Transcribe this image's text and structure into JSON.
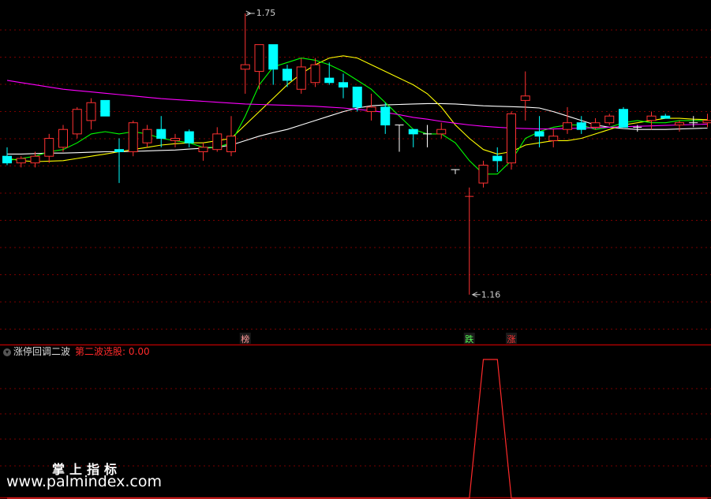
{
  "chart_data": [
    {
      "type": "candlestick",
      "ylim": [
        1.05,
        1.82
      ],
      "grid": true,
      "candles": [
        {
          "o": 1.47,
          "h": 1.49,
          "l": 1.45,
          "c": 1.455,
          "up": false
        },
        {
          "o": 1.455,
          "h": 1.47,
          "l": 1.445,
          "c": 1.465,
          "up": true
        },
        {
          "o": 1.455,
          "h": 1.48,
          "l": 1.445,
          "c": 1.47,
          "up": true
        },
        {
          "o": 1.47,
          "h": 1.52,
          "l": 1.455,
          "c": 1.51,
          "up": true
        },
        {
          "o": 1.49,
          "h": 1.54,
          "l": 1.48,
          "c": 1.53,
          "up": true
        },
        {
          "o": 1.52,
          "h": 1.58,
          "l": 1.51,
          "c": 1.575,
          "up": true
        },
        {
          "o": 1.55,
          "h": 1.6,
          "l": 1.53,
          "c": 1.59,
          "up": true
        },
        {
          "o": 1.595,
          "h": 1.595,
          "l": 1.56,
          "c": 1.56,
          "up": false
        },
        {
          "o": 1.485,
          "h": 1.51,
          "l": 1.41,
          "c": 1.48,
          "up": false
        },
        {
          "o": 1.48,
          "h": 1.55,
          "l": 1.47,
          "c": 1.545,
          "up": true
        },
        {
          "o": 1.5,
          "h": 1.54,
          "l": 1.49,
          "c": 1.53,
          "up": true
        },
        {
          "o": 1.53,
          "h": 1.56,
          "l": 1.49,
          "c": 1.51,
          "up": false
        },
        {
          "o": 1.51,
          "h": 1.52,
          "l": 1.49,
          "c": 1.505,
          "up": true
        },
        {
          "o": 1.525,
          "h": 1.53,
          "l": 1.49,
          "c": 1.5,
          "up": false
        },
        {
          "o": 1.48,
          "h": 1.5,
          "l": 1.46,
          "c": 1.49,
          "up": true
        },
        {
          "o": 1.485,
          "h": 1.535,
          "l": 1.48,
          "c": 1.52,
          "up": true
        },
        {
          "o": 1.48,
          "h": 1.56,
          "l": 1.47,
          "c": 1.515,
          "up": true
        },
        {
          "o": 1.665,
          "h": 1.79,
          "l": 1.61,
          "c": 1.675,
          "up": true
        },
        {
          "o": 1.72,
          "h": 1.72,
          "l": 1.62,
          "c": 1.66,
          "up": true
        },
        {
          "o": 1.72,
          "h": 1.72,
          "l": 1.63,
          "c": 1.665,
          "up": false
        },
        {
          "o": 1.665,
          "h": 1.675,
          "l": 1.625,
          "c": 1.64,
          "up": false
        },
        {
          "o": 1.62,
          "h": 1.69,
          "l": 1.61,
          "c": 1.67,
          "up": true
        },
        {
          "o": 1.635,
          "h": 1.69,
          "l": 1.625,
          "c": 1.675,
          "up": true
        },
        {
          "o": 1.645,
          "h": 1.68,
          "l": 1.63,
          "c": 1.635,
          "up": false
        },
        {
          "o": 1.635,
          "h": 1.655,
          "l": 1.6,
          "c": 1.625,
          "up": false
        },
        {
          "o": 1.625,
          "h": 1.625,
          "l": 1.57,
          "c": 1.58,
          "up": false
        },
        {
          "o": 1.58,
          "h": 1.61,
          "l": 1.55,
          "c": 1.57,
          "up": true
        },
        {
          "o": 1.58,
          "h": 1.59,
          "l": 1.52,
          "c": 1.54,
          "up": false
        },
        {
          "o": 1.54,
          "h": 1.54,
          "l": 1.48,
          "c": 1.54,
          "up": false
        },
        {
          "o": 1.53,
          "h": 1.53,
          "l": 1.49,
          "c": 1.52,
          "up": false
        },
        {
          "o": 1.52,
          "h": 1.54,
          "l": 1.49,
          "c": 1.52,
          "up": false
        },
        {
          "o": 1.52,
          "h": 1.545,
          "l": 1.51,
          "c": 1.53,
          "up": true
        },
        {
          "o": 1.44,
          "h": 1.44,
          "l": 1.43,
          "c": 1.44,
          "up": false
        },
        {
          "o": 1.38,
          "h": 1.4,
          "l": 1.16,
          "c": 1.38,
          "up": true
        },
        {
          "o": 1.41,
          "h": 1.46,
          "l": 1.4,
          "c": 1.45,
          "up": true
        },
        {
          "o": 1.46,
          "h": 1.49,
          "l": 1.435,
          "c": 1.47,
          "up": false
        },
        {
          "o": 1.455,
          "h": 1.57,
          "l": 1.44,
          "c": 1.565,
          "up": true
        },
        {
          "o": 1.595,
          "h": 1.66,
          "l": 1.55,
          "c": 1.605,
          "up": true
        },
        {
          "o": 1.525,
          "h": 1.56,
          "l": 1.49,
          "c": 1.515,
          "up": false
        },
        {
          "o": 1.505,
          "h": 1.53,
          "l": 1.49,
          "c": 1.515,
          "up": true
        },
        {
          "o": 1.53,
          "h": 1.58,
          "l": 1.52,
          "c": 1.545,
          "up": true
        },
        {
          "o": 1.545,
          "h": 1.56,
          "l": 1.52,
          "c": 1.53,
          "up": false
        },
        {
          "o": 1.535,
          "h": 1.555,
          "l": 1.53,
          "c": 1.545,
          "up": true
        },
        {
          "o": 1.545,
          "h": 1.565,
          "l": 1.54,
          "c": 1.56,
          "up": true
        },
        {
          "o": 1.575,
          "h": 1.58,
          "l": 1.535,
          "c": 1.535,
          "up": false
        },
        {
          "o": 1.535,
          "h": 1.54,
          "l": 1.525,
          "c": 1.535,
          "up": false
        },
        {
          "o": 1.55,
          "h": 1.57,
          "l": 1.53,
          "c": 1.56,
          "up": true
        },
        {
          "o": 1.56,
          "h": 1.565,
          "l": 1.555,
          "c": 1.555,
          "up": false
        },
        {
          "o": 1.54,
          "h": 1.55,
          "l": 1.525,
          "c": 1.545,
          "up": true
        },
        {
          "o": 1.545,
          "h": 1.56,
          "l": 1.535,
          "c": 1.545,
          "up": false
        },
        {
          "o": 1.545,
          "h": 1.565,
          "l": 1.535,
          "c": 1.55,
          "up": true
        }
      ],
      "series": [
        {
          "color": "#ffffff",
          "values": [
            1.475,
            1.475,
            1.476,
            1.477,
            1.477,
            1.478,
            1.479,
            1.48,
            1.48,
            1.481,
            1.482,
            1.483,
            1.484,
            1.486,
            1.488,
            1.49,
            1.495,
            1.505,
            1.515,
            1.523,
            1.53,
            1.54,
            1.55,
            1.56,
            1.57,
            1.578,
            1.583,
            1.585,
            1.586,
            1.587,
            1.588,
            1.588,
            1.587,
            1.585,
            1.583,
            1.582,
            1.581,
            1.58,
            1.578,
            1.57,
            1.56,
            1.55,
            1.54,
            1.535,
            1.532,
            1.53,
            1.53,
            1.53,
            1.531,
            1.532,
            1.533
          ]
        },
        {
          "color": "#ffff00",
          "values": [
            1.465,
            1.46,
            1.458,
            1.459,
            1.46,
            1.465,
            1.47,
            1.475,
            1.48,
            1.485,
            1.49,
            1.495,
            1.498,
            1.5,
            1.5,
            1.505,
            1.51,
            1.54,
            1.57,
            1.6,
            1.63,
            1.655,
            1.675,
            1.69,
            1.695,
            1.69,
            1.675,
            1.66,
            1.645,
            1.63,
            1.61,
            1.58,
            1.54,
            1.51,
            1.485,
            1.475,
            1.48,
            1.495,
            1.5,
            1.505,
            1.505,
            1.51,
            1.52,
            1.53,
            1.54,
            1.545,
            1.55,
            1.555,
            1.555,
            1.553,
            1.552
          ]
        },
        {
          "color": "#00ff00",
          "values": [
            1.46,
            1.465,
            1.47,
            1.48,
            1.485,
            1.5,
            1.52,
            1.525,
            1.52,
            1.525,
            1.52,
            1.51,
            1.505,
            1.5,
            1.49,
            1.49,
            1.5,
            1.56,
            1.63,
            1.67,
            1.68,
            1.69,
            1.685,
            1.675,
            1.66,
            1.64,
            1.62,
            1.59,
            1.56,
            1.53,
            1.52,
            1.52,
            1.5,
            1.46,
            1.43,
            1.43,
            1.46,
            1.51,
            1.525,
            1.535,
            1.54,
            1.54,
            1.53,
            1.535,
            1.545,
            1.55,
            1.545,
            1.545,
            1.55,
            1.55,
            1.55
          ]
        },
        {
          "color": "#ff00ff",
          "values": [
            1.64,
            1.635,
            1.63,
            1.625,
            1.62,
            1.617,
            1.614,
            1.611,
            1.608,
            1.605,
            1.602,
            1.599,
            1.597,
            1.595,
            1.593,
            1.591,
            1.589,
            1.587,
            1.586,
            1.585,
            1.584,
            1.583,
            1.582,
            1.58,
            1.578,
            1.575,
            1.572,
            1.568,
            1.563,
            1.557,
            1.553,
            1.548,
            1.544,
            1.54,
            1.537,
            1.535,
            1.533,
            1.532,
            1.531,
            1.531,
            1.532,
            1.533,
            1.534,
            1.535,
            1.536,
            1.537,
            1.538,
            1.539,
            1.54,
            1.541,
            1.542
          ]
        }
      ],
      "annotations": {
        "high": {
          "label": "1.75",
          "index": 17,
          "value": 1.79
        },
        "low": {
          "label": "1.16",
          "index": 33,
          "value": 1.16
        }
      },
      "markers": [
        {
          "index": 17,
          "label": "榜",
          "color": "#ff9999"
        },
        {
          "index": 33,
          "label": "跌",
          "color": "#55ff55"
        },
        {
          "index": 36,
          "label": "涨",
          "color": "#ff3333"
        }
      ],
      "colors": {
        "up": "#ff3232",
        "down": "#00ffff",
        "grid": "#7a0000",
        "panel_line": "#aa0000"
      }
    },
    {
      "type": "line",
      "title": "涨停回调二波",
      "signal_label": "第二波选股: 0.00",
      "ylim": [
        0,
        1
      ],
      "values": [
        0,
        0,
        0,
        0,
        0,
        0,
        0,
        0,
        0,
        0,
        0,
        0,
        0,
        0,
        0,
        0,
        0,
        0,
        0,
        0,
        0,
        0,
        0,
        0,
        0,
        0,
        0,
        0,
        0,
        0,
        0,
        0,
        0,
        0,
        1,
        1,
        0,
        0,
        0,
        0,
        0,
        0,
        0,
        0,
        0,
        0,
        0,
        0,
        0,
        0,
        0
      ],
      "color": "#ff2a2a"
    }
  ],
  "watermark": {
    "cn": "掌上指标",
    "url": "www.palmindex.com"
  }
}
